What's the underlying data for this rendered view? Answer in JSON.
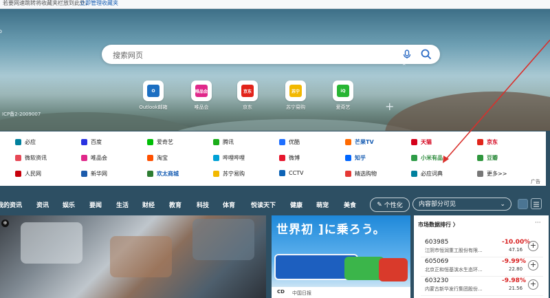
{
  "topbar": {
    "note": "若要网速跳转将收藏夹栏放到此处，",
    "link": "立即管理收藏夹"
  },
  "hero": {
    "search_placeholder": "搜索网页",
    "caret": "⌃",
    "left_edge": "o",
    "icp": "ICP备2-2009007",
    "tiles": [
      {
        "label": "Outlook邮箱",
        "icon": "outlook-icon",
        "short": "O",
        "color": "#1b6ec2"
      },
      {
        "label": "唯品会",
        "icon": "vipshop-icon",
        "short": "唯品会",
        "color": "#e0288a"
      },
      {
        "label": "京东",
        "icon": "jd-icon",
        "short": "京东",
        "color": "#e2231a"
      },
      {
        "label": "苏宁易购",
        "icon": "suning-icon",
        "short": "苏宁",
        "color": "#f2b800"
      },
      {
        "label": "爱奇艺",
        "icon": "iqiyi-icon",
        "short": "iQ",
        "color": "#27b533"
      }
    ],
    "add": "+"
  },
  "sites": {
    "rows": [
      [
        {
          "label": "必应",
          "color": "#00809d",
          "icon": "bing-icon",
          "style": "normal"
        },
        {
          "label": "百度",
          "color": "#2932e1",
          "icon": "baidu-icon",
          "style": "normal"
        },
        {
          "label": "爱奇艺",
          "color": "#00be06",
          "icon": "iqiyi-icon",
          "style": "normal"
        },
        {
          "label": "腾讯",
          "color": "#1aad19",
          "icon": "tencent-icon",
          "style": "normal"
        },
        {
          "label": "优酷",
          "color": "#1f6fff",
          "icon": "youku-icon",
          "style": "normal"
        },
        {
          "label": "芒果TV",
          "color": "#ff6a00",
          "icon": "mgtv-icon",
          "style": "blue"
        },
        {
          "label": "天猫",
          "color": "#d4001a",
          "icon": "tmall-icon",
          "style": "red"
        },
        {
          "label": "京东",
          "color": "#e1251b",
          "icon": "jd-icon",
          "style": "red"
        }
      ],
      [
        {
          "label": "微软资讯",
          "color": "#e74856",
          "icon": "msn-icon",
          "style": "normal"
        },
        {
          "label": "唯品会",
          "color": "#e0288a",
          "icon": "vipshop-icon",
          "style": "normal"
        },
        {
          "label": "淘宝",
          "color": "#ff5000",
          "icon": "taobao-icon",
          "style": "normal"
        },
        {
          "label": "哔哩哔哩",
          "color": "#00a1d6",
          "icon": "bilibili-icon",
          "style": "normal"
        },
        {
          "label": "微博",
          "color": "#e6162d",
          "icon": "weibo-icon",
          "style": "normal"
        },
        {
          "label": "知乎",
          "color": "#0066ff",
          "icon": "zhihu-icon",
          "style": "blue"
        },
        {
          "label": "小米有品",
          "color": "#2e9c47",
          "icon": "xiaomi-youpin-icon",
          "style": "green"
        },
        {
          "label": "豆瓣",
          "color": "#2e963d",
          "icon": "douban-icon",
          "style": "green"
        }
      ],
      [
        {
          "label": "人民网",
          "color": "#c7000b",
          "icon": "people-icon",
          "style": "normal"
        },
        {
          "label": "新华网",
          "color": "#1c5bab",
          "icon": "xinhua-icon",
          "style": "normal"
        },
        {
          "label": "欢太商城",
          "color": "#2e7d32",
          "icon": "heytap-icon",
          "style": "blue"
        },
        {
          "label": "苏宁易购",
          "color": "#f2b800",
          "icon": "suning-icon",
          "style": "normal"
        },
        {
          "label": "CCTV",
          "color": "#0d63b6",
          "icon": "cctv-icon",
          "style": "normal"
        },
        {
          "label": "精选购物",
          "color": "#e53935",
          "icon": "shopping-icon",
          "style": "normal"
        },
        {
          "label": "必应词典",
          "color": "#00809d",
          "icon": "bing-dict-icon",
          "style": "normal"
        },
        {
          "label": "更多>>",
          "color": "#777777",
          "icon": "more-icon",
          "style": "normal"
        }
      ]
    ],
    "ad_label": "广告"
  },
  "nav": {
    "items": [
      "我的资讯",
      "资讯",
      "娱乐",
      "要闻",
      "生活",
      "财经",
      "教育",
      "科技",
      "体育",
      "悦读天下",
      "健康",
      "萌宠",
      "美食"
    ],
    "personalize": "个性化",
    "content_select": "内容部分可见"
  },
  "feed": {
    "badge": "⊕"
  },
  "ad_card": {
    "title": "世界初 ]に乗ろう。",
    "source_logo": "CD",
    "source": "中国日报"
  },
  "market": {
    "title": "市场数据排行 〉",
    "more": "···",
    "stocks": [
      {
        "code": "603985",
        "name": "江阴市恒润重工股份有限...",
        "change": "-10.00%",
        "price": "47.16"
      },
      {
        "code": "605069",
        "name": "北京正和恒基滨水生态环...",
        "change": "-9.99%",
        "price": "22.80"
      },
      {
        "code": "603230",
        "name": "内蒙古新华发行集团股份...",
        "change": "-9.98%",
        "price": "21.56"
      }
    ],
    "down_color": "#d71e1e"
  },
  "colors": {
    "annotation_arrow": "#d9302c",
    "link": "#1a5fb4"
  }
}
